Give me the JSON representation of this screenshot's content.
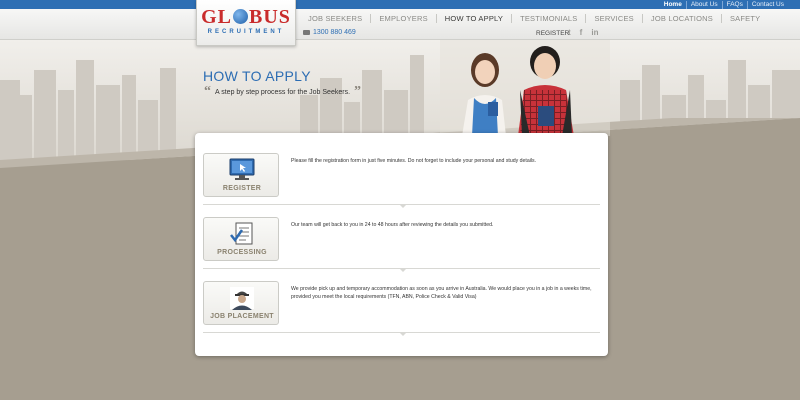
{
  "top_links": [
    "Home",
    "About Us",
    "FAQs",
    "Contact Us"
  ],
  "logo": {
    "word_left": "GL",
    "word_right": "BUS",
    "subtitle": "RECRUITMENT"
  },
  "nav": [
    {
      "label": "JOB SEEKERS",
      "active": false
    },
    {
      "label": "EMPLOYERS",
      "active": false
    },
    {
      "label": "HOW TO APPLY",
      "active": true
    },
    {
      "label": "TESTIMONIALS",
      "active": false
    },
    {
      "label": "SERVICES",
      "active": false
    },
    {
      "label": "JOB LOCATIONS",
      "active": false
    },
    {
      "label": "SAFETY",
      "active": false
    }
  ],
  "phone": "1300 880 469",
  "register_link": "REGISTER",
  "socials": {
    "twitter": "t",
    "facebook": "f",
    "linkedin": "in"
  },
  "hero": {
    "title": "HOW TO APPLY",
    "subtitle": "A step by step process for the Job Seekers.",
    "open_quote": "“",
    "close_quote": "”"
  },
  "steps": [
    {
      "label": "REGISTER",
      "icon": "monitor-cursor-icon",
      "text": "Please fill the registration form in just five minutes. Do not forget to include your personal and study details."
    },
    {
      "label": "PROCESSING",
      "icon": "document-check-icon",
      "text": "Our team will get back to you in 24 to 48 hours after reviewing the details you submitted."
    },
    {
      "label": "JOB PLACEMENT",
      "icon": "worker-helmet-icon",
      "text": "We provide pick up and temporary accommodation as soon as you arrive in Australia. We would place you in a job in a weeks time, provided you meet the local requirements (TFN, ABN, Police Check & Valid Visa)"
    }
  ],
  "colors": {
    "brand_blue": "#2e6fb4",
    "brand_red": "#c92b2b",
    "lower_bg": "#a69e90"
  }
}
